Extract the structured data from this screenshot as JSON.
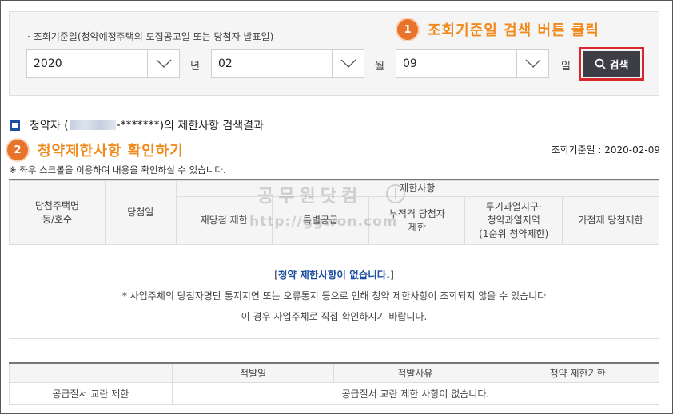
{
  "search": {
    "label": "· 조회기준일(청약예정주택의 모집공고일 또는 당첨자 발표일)",
    "year_value": "2020",
    "year_unit": "년",
    "month_value": "02",
    "month_unit": "월",
    "day_value": "09",
    "day_unit": "일",
    "search_button_label": "검색"
  },
  "annotations": {
    "step1_number": "1",
    "step1_text": "조회기준일 검색 버튼 클릭",
    "step2_number": "2",
    "step2_text": "청약제한사항 확인하기"
  },
  "result": {
    "title_prefix": "청약자 (",
    "title_masked_id": "-*******",
    "title_suffix": ")의 제한사항 검색결과",
    "reference_date": "조회기준일 : 2020-02-09",
    "scroll_note": "※ 좌우 스크롤을 이용하여 내용을 확인하실 수 있습니다."
  },
  "restriction_table": {
    "col_house_line1": "당첨주택명",
    "col_house_line2": "동/호수",
    "col_win_date": "당첨일",
    "group_header": "제한사항",
    "col_rewin": "재당첨 제한",
    "col_special": "특별공급",
    "col_unqualified_line1": "부적격 당첨자",
    "col_unqualified_line2": "제한",
    "col_speculative_line1": "투기과열지구·",
    "col_speculative_line2": "청약과열지역",
    "col_speculative_line3": "(1순위 청약제한)",
    "col_point": "가점제 당첨제한",
    "empty_message_open": "[",
    "empty_message": "청약 제한사항이 없습니다.",
    "empty_message_close": "]",
    "info_line1": "* 사업주체의 당첨자명단 통지지연 또는 오류통지 등으로 인해 청약 제한사항이 조회되지 않을 수 있습니다",
    "info_line2": "이 경우 사업주체로 직접 확인하시기 바랍니다."
  },
  "order_table": {
    "col_found_date": "적발일",
    "col_reason": "적발사유",
    "col_period": "청약 제한기한",
    "row_label": "공급질서 교란 제한",
    "row_message": "공급질서 교란 제한 사항이 없습니다."
  },
  "watermark": {
    "line1": "공무원닷컴",
    "line2": "http://ggwon.com"
  },
  "colors": {
    "accent_orange": "#e8732a",
    "highlight_red": "#d9262c",
    "button_dark": "#3d3d46",
    "message_blue": "#1d4fa0"
  }
}
